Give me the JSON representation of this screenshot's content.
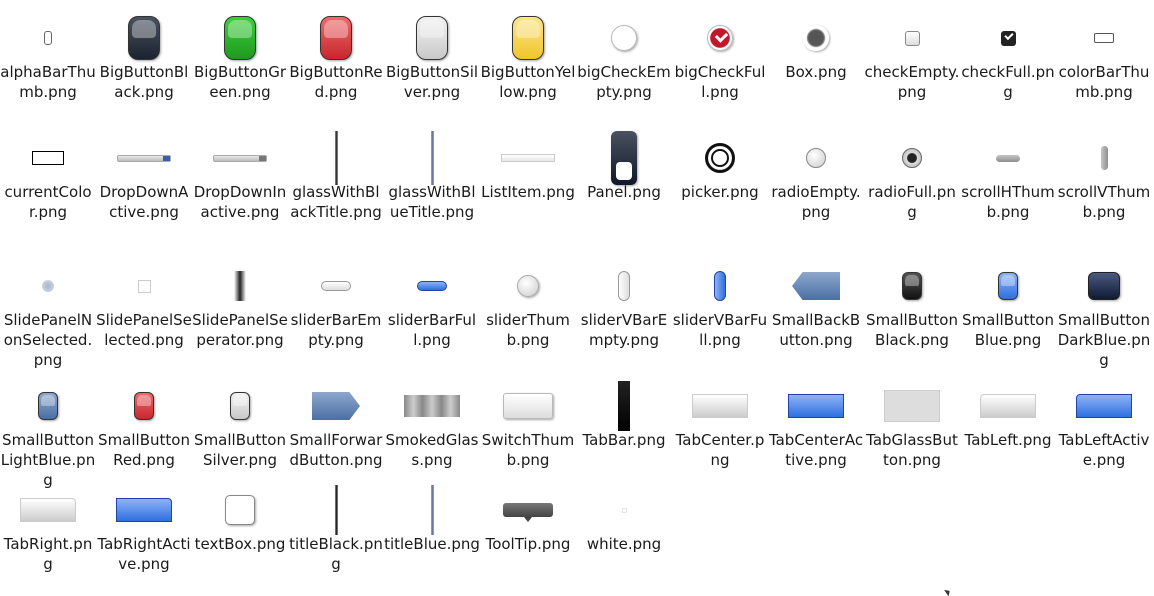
{
  "files": [
    {
      "name": "alphaBarThumb.png",
      "icon": "alpha-bar-thumb-icon"
    },
    {
      "name": "BigButtonBlack.png",
      "icon": "big-button-black-icon",
      "color": "#1c2330"
    },
    {
      "name": "BigButtonGreen.png",
      "icon": "big-button-green-icon",
      "color": "#1e9a1e"
    },
    {
      "name": "BigButtonRed.png",
      "icon": "big-button-red-icon",
      "color": "#c8272d"
    },
    {
      "name": "BigButtonSilver.png",
      "icon": "big-button-silver-icon",
      "color": "#c9c9c9"
    },
    {
      "name": "BigButtonYellow.png",
      "icon": "big-button-yellow-icon",
      "color": "#f0c52b"
    },
    {
      "name": "bigCheckEmpty.png",
      "icon": "big-check-empty-icon"
    },
    {
      "name": "bigCheckFull.png",
      "icon": "big-check-full-icon",
      "color": "#c0182a"
    },
    {
      "name": "Box.png",
      "icon": "box-icon"
    },
    {
      "name": "checkEmpty.png",
      "icon": "check-empty-icon"
    },
    {
      "name": "checkFull.png",
      "icon": "check-full-icon"
    },
    {
      "name": "colorBarThumb.png",
      "icon": "color-bar-thumb-icon"
    },
    {
      "name": "currentColor.png",
      "icon": "current-color-icon"
    },
    {
      "name": "DropDownActive.png",
      "icon": "dropdown-active-icon",
      "color": "#3a5fa8"
    },
    {
      "name": "DropDownInactive.png",
      "icon": "dropdown-inactive-icon"
    },
    {
      "name": "glassWithBlackTitle.png",
      "icon": "glass-black-title-icon"
    },
    {
      "name": "glassWithBlueTitle.png",
      "icon": "glass-blue-title-icon"
    },
    {
      "name": "ListItem.png",
      "icon": "list-item-icon"
    },
    {
      "name": "Panel.png",
      "icon": "panel-icon"
    },
    {
      "name": "picker.png",
      "icon": "picker-icon"
    },
    {
      "name": "radioEmpty.png",
      "icon": "radio-empty-icon"
    },
    {
      "name": "radioFull.png",
      "icon": "radio-full-icon"
    },
    {
      "name": "scrollHThumb.png",
      "icon": "scroll-h-thumb-icon"
    },
    {
      "name": "scrollVThumb.png",
      "icon": "scroll-v-thumb-icon"
    },
    {
      "name": "SlidePanelNonSelected.png",
      "icon": "slide-panel-nonselected-icon"
    },
    {
      "name": "SlidePanelSelected.png",
      "icon": "slide-panel-selected-icon"
    },
    {
      "name": "SlidePanelSeperator.png",
      "icon": "slide-panel-separator-icon"
    },
    {
      "name": "sliderBarEmpty.png",
      "icon": "slider-bar-empty-icon"
    },
    {
      "name": "sliderBarFull.png",
      "icon": "slider-bar-full-icon",
      "color": "#2f6fe0"
    },
    {
      "name": "sliderThumb.png",
      "icon": "slider-thumb-icon"
    },
    {
      "name": "sliderVBarEmpty.png",
      "icon": "slider-v-bar-empty-icon"
    },
    {
      "name": "sliderVBarFull.png",
      "icon": "slider-v-bar-full-icon",
      "color": "#2f6fe0"
    },
    {
      "name": "SmallBackButton.png",
      "icon": "small-back-button-icon",
      "color": "#4a6fa5"
    },
    {
      "name": "SmallButtonBlack.png",
      "icon": "small-button-black-icon",
      "color": "#111111"
    },
    {
      "name": "SmallButtonBlue.png",
      "icon": "small-button-blue-icon",
      "color": "#2f6fe0"
    },
    {
      "name": "SmallButtonDarkBlue.png",
      "icon": "small-button-dark-blue-icon",
      "color": "#0f1a33"
    },
    {
      "name": "SmallButtonLightBlue.png",
      "icon": "small-button-light-blue-icon",
      "color": "#4a6fa5"
    },
    {
      "name": "SmallButtonRed.png",
      "icon": "small-button-red-icon",
      "color": "#c8272d"
    },
    {
      "name": "SmallButtonSilver.png",
      "icon": "small-button-silver-icon",
      "color": "#c9c9c9"
    },
    {
      "name": "SmallForwardButton.png",
      "icon": "small-forward-button-icon",
      "color": "#4a6fa5"
    },
    {
      "name": "SmokedGlass.png",
      "icon": "smoked-glass-icon"
    },
    {
      "name": "SwitchThumb.png",
      "icon": "switch-thumb-icon"
    },
    {
      "name": "TabBar.png",
      "icon": "tab-bar-icon"
    },
    {
      "name": "TabCenter.png",
      "icon": "tab-center-icon"
    },
    {
      "name": "TabCenterActive.png",
      "icon": "tab-center-active-icon",
      "color": "#2f6fe0"
    },
    {
      "name": "TabGlassButton.png",
      "icon": "tab-glass-button-icon"
    },
    {
      "name": "TabLeft.png",
      "icon": "tab-left-icon"
    },
    {
      "name": "TabLeftActive.png",
      "icon": "tab-left-active-icon",
      "color": "#2f6fe0"
    },
    {
      "name": "TabRight.png",
      "icon": "tab-right-icon"
    },
    {
      "name": "TabRightActive.png",
      "icon": "tab-right-active-icon",
      "color": "#2f6fe0"
    },
    {
      "name": "textBox.png",
      "icon": "text-box-icon"
    },
    {
      "name": "titleBlack.png",
      "icon": "title-black-icon"
    },
    {
      "name": "titleBlue.png",
      "icon": "title-blue-icon"
    },
    {
      "name": "ToolTip.png",
      "icon": "tooltip-icon"
    },
    {
      "name": "white.png",
      "icon": "white-icon"
    }
  ]
}
